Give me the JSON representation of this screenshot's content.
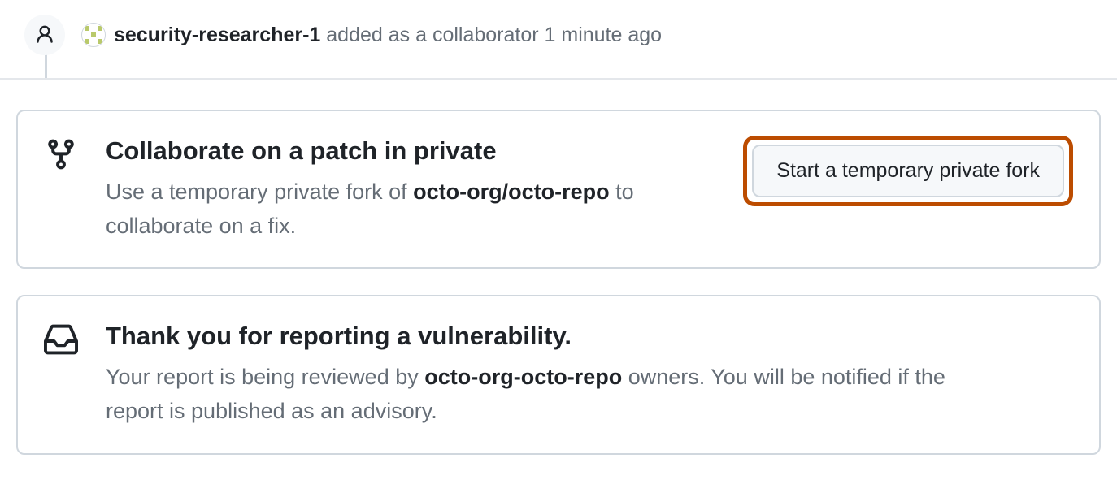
{
  "timeline": {
    "username": "security-researcher-1",
    "action_text": " added as a collaborator ",
    "timestamp": "1 minute ago"
  },
  "card_collab": {
    "title": "Collaborate on a patch in private",
    "desc_prefix": "Use a temporary private fork of ",
    "repo": "octo-org/octo-repo",
    "desc_suffix": " to collaborate on a fix.",
    "button": "Start a temporary private fork"
  },
  "card_thanks": {
    "title": "Thank you for reporting a vulnerability.",
    "desc_prefix": "Your report is being reviewed by ",
    "repo_owner": "octo-org-octo-repo",
    "desc_suffix": " owners. You will be notified if the report is published as an advisory."
  }
}
